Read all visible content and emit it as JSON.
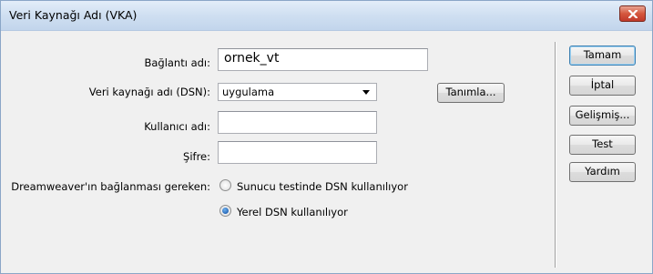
{
  "window": {
    "title": "Veri Kaynağı Adı (VKA)"
  },
  "form": {
    "connection_name_label": "Bağlantı adı:",
    "connection_name_value": "ornek_vt",
    "dsn_label": "Veri kaynağı adı (DSN):",
    "dsn_selected": "uygulama",
    "define_button": "Tanımla...",
    "username_label": "Kullanıcı adı:",
    "username_value": "",
    "password_label": "Şifre:",
    "password_value": "",
    "connect_label": "Dreamweaver'ın bağlanması gereken:",
    "radio_options": [
      {
        "label": "Sunucu testinde DSN kullanılıyor",
        "checked": false
      },
      {
        "label": "Yerel DSN kullanılıyor",
        "checked": true
      }
    ]
  },
  "side_buttons": {
    "ok": "Tamam",
    "cancel": "İptal",
    "advanced": "Gelişmiş...",
    "test": "Test",
    "help": "Yardım"
  },
  "colors": {
    "title_bar": "#cfdff1",
    "close_button": "#c0392b",
    "radio_checked": "#1f5fb0"
  }
}
